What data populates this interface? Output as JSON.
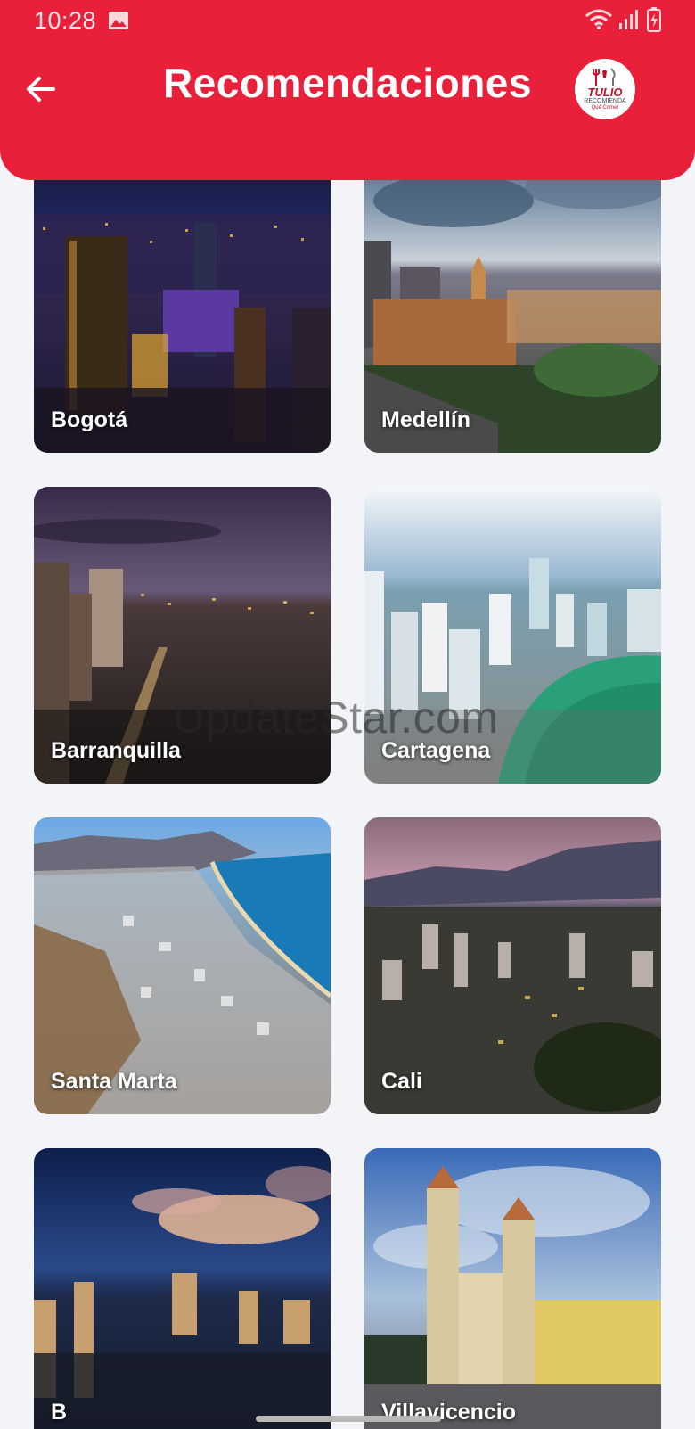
{
  "status_bar": {
    "time": "10:28"
  },
  "header": {
    "title": "Recomendaciones",
    "back_icon": "arrow-left-icon",
    "logo": {
      "line1": "TULIO",
      "line2": "RECOMIENDA",
      "line3": "Qué Comer"
    }
  },
  "cities": [
    {
      "name": "Bogotá"
    },
    {
      "name": "Medellín"
    },
    {
      "name": "Barranquilla"
    },
    {
      "name": "Cartagena"
    },
    {
      "name": "Santa Marta"
    },
    {
      "name": "Cali"
    },
    {
      "name": "B"
    },
    {
      "name": "Villavicencio"
    }
  ],
  "watermark": "UpdateStar.com",
  "colors": {
    "accent": "#e8203a",
    "background": "#f2f4f7"
  }
}
